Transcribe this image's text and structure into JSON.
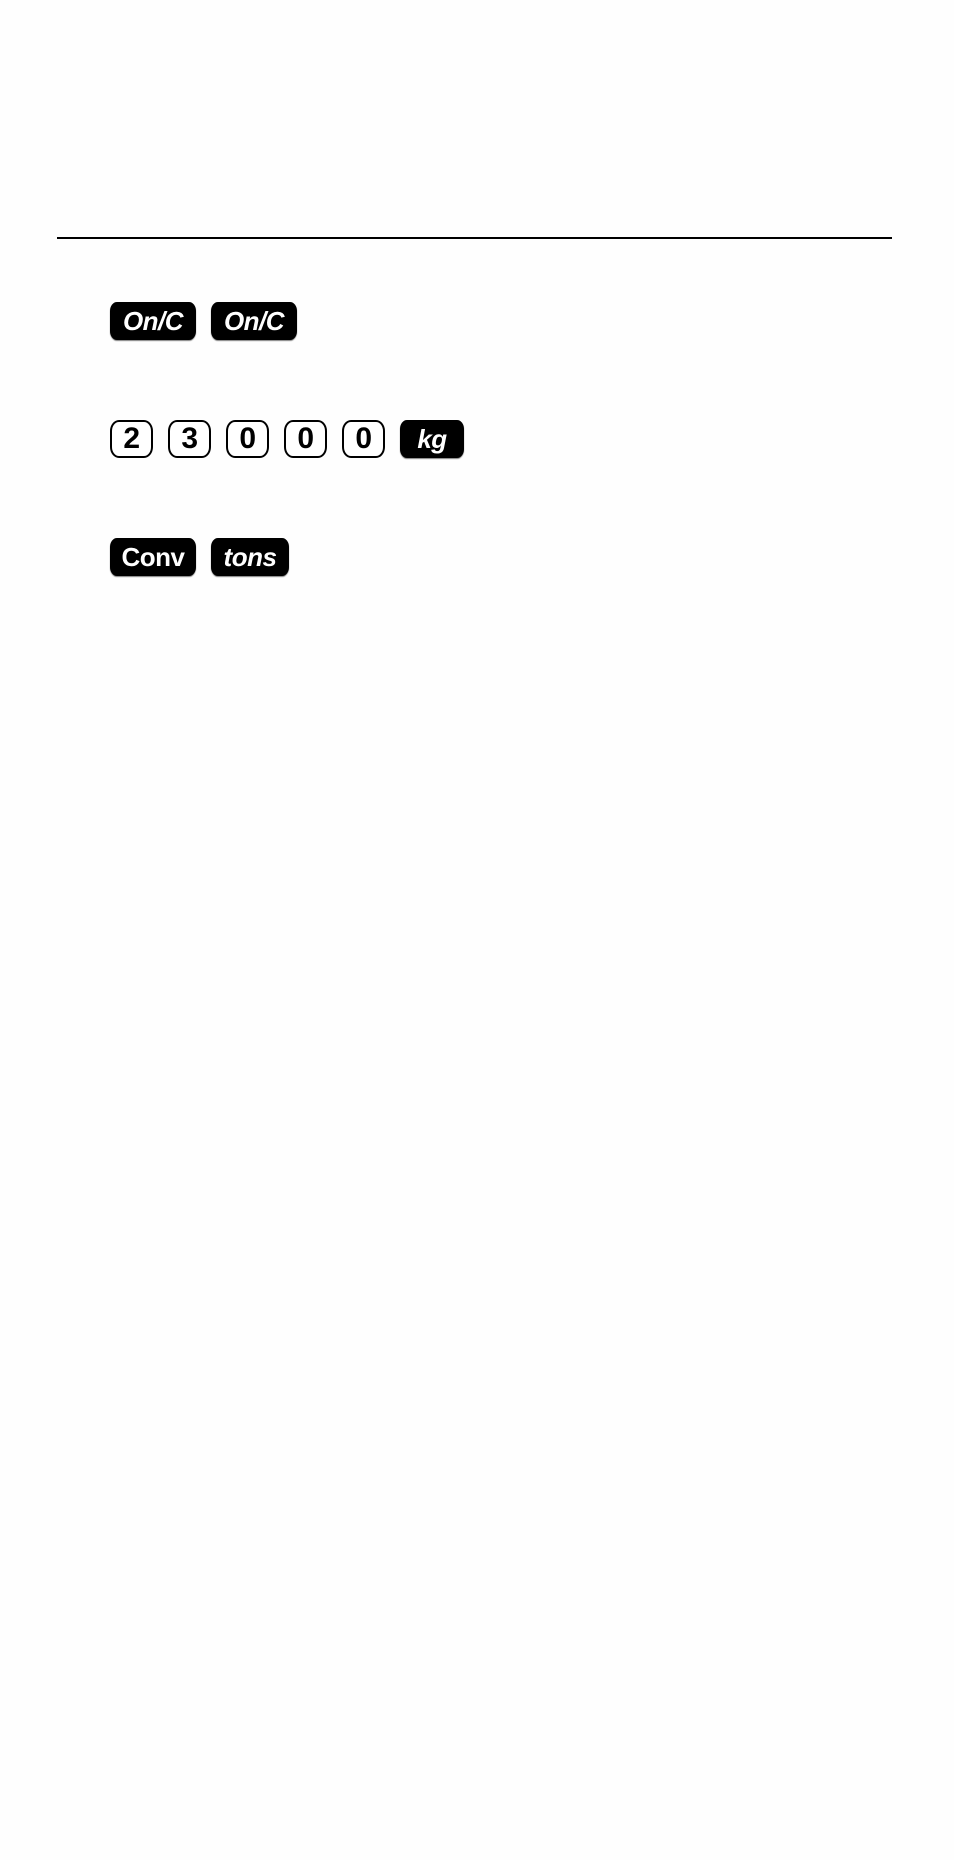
{
  "document": {
    "steps": [
      {
        "keys": [
          {
            "label": "On/C",
            "style": "black",
            "italic": true
          },
          {
            "label": "On/C",
            "style": "black",
            "italic": true
          }
        ]
      },
      {
        "keys": [
          {
            "label": "2",
            "style": "white",
            "italic": false
          },
          {
            "label": "3",
            "style": "white",
            "italic": false
          },
          {
            "label": "0",
            "style": "white",
            "italic": false
          },
          {
            "label": "0",
            "style": "white",
            "italic": false
          },
          {
            "label": "0",
            "style": "white",
            "italic": false
          },
          {
            "label": "kg",
            "style": "black",
            "italic": true
          }
        ]
      },
      {
        "keys": [
          {
            "label": "Conv",
            "style": "black",
            "italic": false
          },
          {
            "label": "tons",
            "style": "black",
            "italic": true
          }
        ]
      }
    ]
  },
  "colors": {
    "key_black": "#000000",
    "key_text_light": "#ffffff",
    "background": "#fefefe"
  }
}
